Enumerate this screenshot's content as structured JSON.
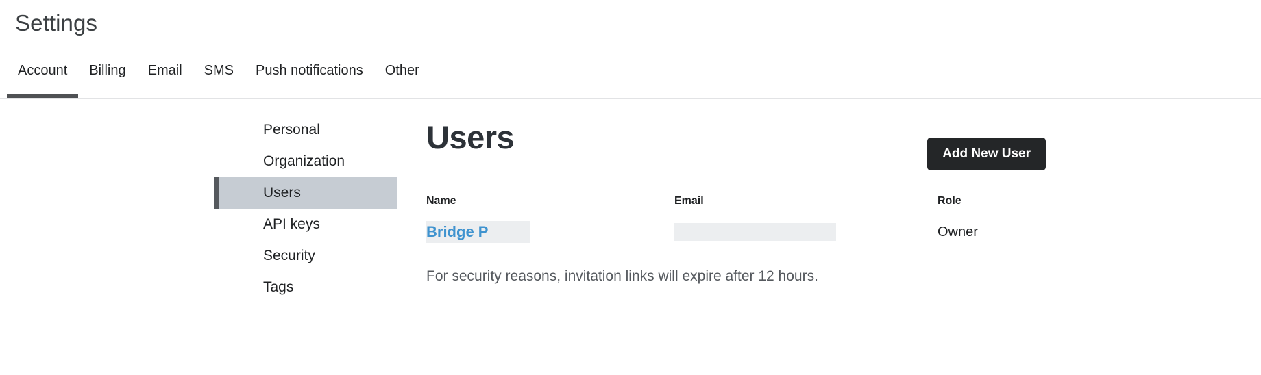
{
  "header": {
    "title": "Settings"
  },
  "tabs": {
    "items": [
      {
        "label": "Account",
        "active": true
      },
      {
        "label": "Billing",
        "active": false
      },
      {
        "label": "Email",
        "active": false
      },
      {
        "label": "SMS",
        "active": false
      },
      {
        "label": "Push notifications",
        "active": false
      },
      {
        "label": "Other",
        "active": false
      }
    ]
  },
  "sidebar": {
    "items": [
      {
        "label": "Personal",
        "active": false
      },
      {
        "label": "Organization",
        "active": false
      },
      {
        "label": "Users",
        "active": true
      },
      {
        "label": "API keys",
        "active": false
      },
      {
        "label": "Security",
        "active": false
      },
      {
        "label": "Tags",
        "active": false
      }
    ]
  },
  "main": {
    "title": "Users",
    "add_user_label": "Add New User",
    "table": {
      "columns": [
        "Name",
        "Email",
        "Role"
      ],
      "rows": [
        {
          "name": "Bridge P",
          "email": "",
          "role": "Owner"
        }
      ]
    },
    "footnote": "For security reasons, invitation links will expire after 12 hours."
  },
  "colors": {
    "accent_dark": "#242628",
    "active_tab_underline": "#4f5154",
    "sidebar_active_bg": "#c6ccd3",
    "sidebar_active_bar": "#55595e",
    "link_blue": "#3f93cf",
    "redaction": "#eceef0",
    "divider": "#dcdee0",
    "text_primary": "#1f2123",
    "text_muted": "#55595e"
  }
}
